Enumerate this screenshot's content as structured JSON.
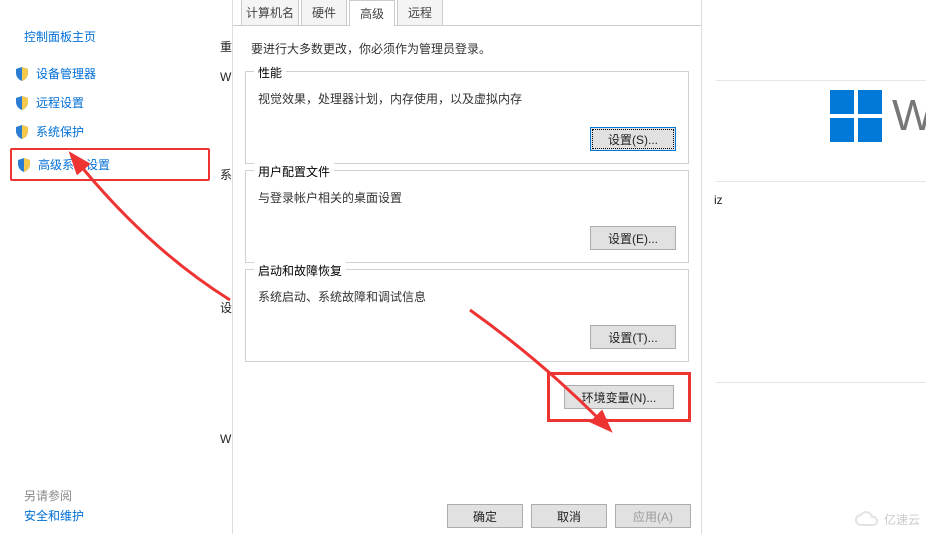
{
  "sidebar": {
    "title": "控制面板主页",
    "items": [
      "设备管理器",
      "远程设置",
      "系统保护",
      "高级系统设置"
    ],
    "see_also_label": "另请参阅",
    "see_also_item": "安全和维护"
  },
  "left_letters": [
    "重",
    "W",
    "系",
    "设",
    "W"
  ],
  "dialog": {
    "tabs": [
      "计算机名",
      "硬件",
      "高级",
      "远程"
    ],
    "active_tab": 2,
    "intro": "要进行大多数更改，你必须作为管理员登录。",
    "groups": {
      "perf": {
        "legend": "性能",
        "desc": "视觉效果，处理器计划，内存使用，以及虚拟内存",
        "btn": "设置(S)..."
      },
      "profile": {
        "legend": "用户配置文件",
        "desc": "与登录帐户相关的桌面设置",
        "btn": "设置(E)..."
      },
      "startup": {
        "legend": "启动和故障恢复",
        "desc": "系统启动、系统故障和调试信息",
        "btn": "设置(T)..."
      }
    },
    "env_btn": "环境变量(N)...",
    "buttons": {
      "ok": "确定",
      "cancel": "取消",
      "apply": "应用(A)"
    }
  },
  "right": {
    "hz": "iz",
    "win_text": "Wi"
  },
  "watermark": "亿速云"
}
